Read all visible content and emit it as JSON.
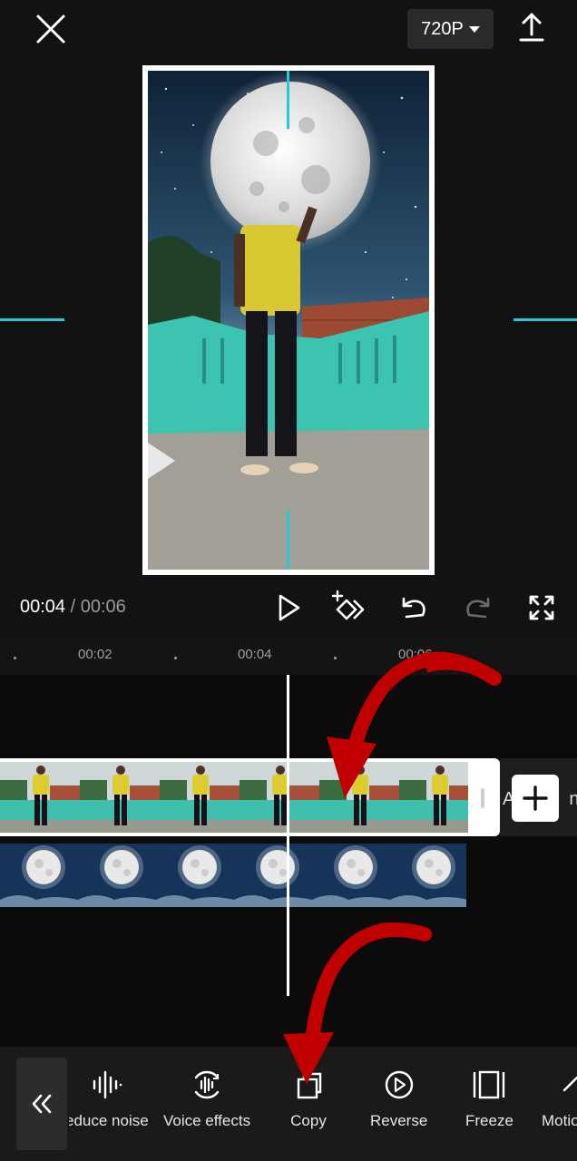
{
  "topbar": {
    "resolution": "720P"
  },
  "playback": {
    "current_time": "00:04",
    "separator": " / ",
    "duration": "00:06"
  },
  "ruler": {
    "labels": [
      "00:02",
      "00:04",
      "00:06"
    ]
  },
  "timeline": {
    "ending_label": "A",
    "ending_label_suffix": "nd"
  },
  "toolbar": {
    "tools": [
      {
        "label": "educe noise",
        "icon": "reduce-noise-icon"
      },
      {
        "label": "Voice effects",
        "icon": "voice-effects-icon"
      },
      {
        "label": "Copy",
        "icon": "copy-icon"
      },
      {
        "label": "Reverse",
        "icon": "reverse-icon"
      },
      {
        "label": "Freeze",
        "icon": "freeze-icon"
      },
      {
        "label": "Motio",
        "icon": "motion-icon"
      }
    ]
  },
  "colors": {
    "accent": "#29c8d6",
    "annotation_arrow": "#c00000",
    "background": "#121212"
  }
}
